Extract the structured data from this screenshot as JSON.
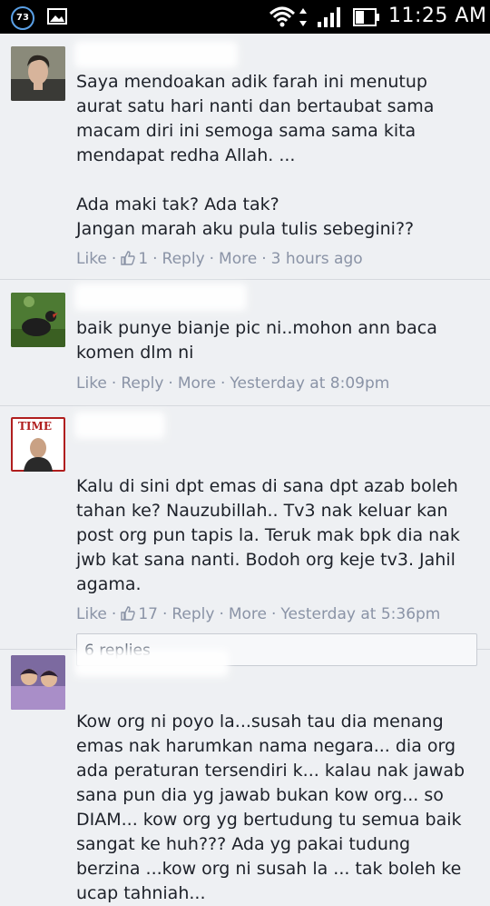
{
  "status_bar": {
    "notification_count": "73",
    "time": "11:25 AM",
    "icons": [
      "notification-badge",
      "image-icon",
      "wifi-icon",
      "data-transfer-icon",
      "signal-icon",
      "battery-icon"
    ]
  },
  "comments": [
    {
      "text": "Saya mendoakan adik farah ini menutup aurat satu hari nanti dan bertaubat sama macam diri ini semoga sama sama kita mendapat redha Allah. ...\n\nAda maki tak? Ada tak?\nJangan marah aku pula tulis sebegini??",
      "like_label": "Like",
      "like_count": "1",
      "reply_label": "Reply",
      "more_label": "More",
      "timestamp": "3 hours ago"
    },
    {
      "text": "baik punye bianje pic ni..mohon ann baca komen dlm ni",
      "like_label": "Like",
      "reply_label": "Reply",
      "more_label": "More",
      "timestamp": "Yesterday at 8:09pm"
    },
    {
      "text": "Kalu di sini dpt emas di sana dpt azab boleh tahan ke? Nauzubillah.. Tv3 nak keluar kan post org pun tapis la. Teruk mak bpk dia nak jwb kat sana nanti. Bodoh org keje tv3. Jahil agama.",
      "like_label": "Like",
      "like_count": "17",
      "reply_label": "Reply",
      "more_label": "More",
      "timestamp": "Yesterday at 5:36pm",
      "replies_label": "6 replies"
    },
    {
      "text": "Kow org ni poyo la...susah tau dia menang emas nak harumkan nama negara... dia org ada peraturan tersendiri k... kalau nak jawab sana pun dia yg jawab bukan kow org... so DIAM... kow org yg bertudung tu semua baik sangat ke huh??? Ada yg pakai tudung berzina ...kow org ni susah la ... tak boleh ke ucap tahniah..."
    }
  ],
  "colors": {
    "background": "#eef0f3",
    "text": "#1d2129",
    "meta": "#8a93a6",
    "divider": "#d6d9de"
  }
}
